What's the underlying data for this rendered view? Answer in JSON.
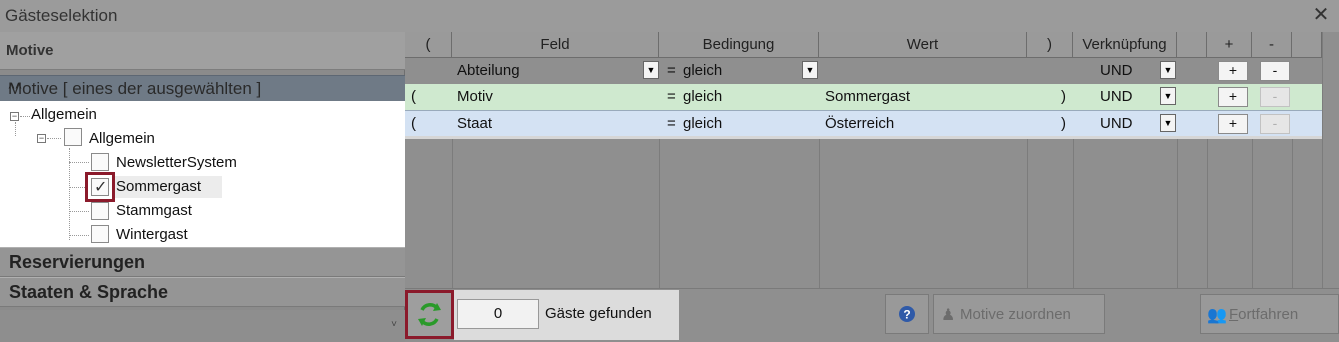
{
  "window": {
    "title": "Gästeselektion",
    "close_icon": "close-icon"
  },
  "left": {
    "motive_header": "Motive",
    "motive_bar": "Motive [ eines der ausgewählten ]",
    "tree": {
      "root": "Allgemein",
      "group": "Allgemein",
      "items": [
        {
          "label": "NewsletterSystem",
          "checked": false
        },
        {
          "label": "Sommergast",
          "checked": true
        },
        {
          "label": "Stammgast",
          "checked": false
        },
        {
          "label": "Wintergast",
          "checked": false
        }
      ]
    },
    "sections": [
      "Reservierungen",
      "Staaten & Sprache"
    ]
  },
  "grid": {
    "headers": [
      "(",
      "Feld",
      "Bedingung",
      "Wert",
      ")",
      "Verknüpfung",
      "+",
      "-"
    ],
    "rows": [
      {
        "open": "",
        "feld": "Abteilung",
        "op": "=",
        "bedingung": "gleich",
        "wert": "",
        "close": "",
        "verkn": "UND",
        "plus": "+",
        "minus": "-",
        "minus_enabled": true
      },
      {
        "open": "(",
        "feld": "Motiv",
        "op": "=",
        "bedingung": "gleich",
        "wert": "Sommergast",
        "close": ")",
        "verkn": "UND",
        "plus": "+",
        "minus": "-",
        "minus_enabled": false
      },
      {
        "open": "(",
        "feld": "Staat",
        "op": "=",
        "bedingung": "gleich",
        "wert": "Österreich",
        "close": ")",
        "verkn": "UND",
        "plus": "+",
        "minus": "-",
        "minus_enabled": false
      }
    ],
    "colors": {
      "row_motiv": "#cfe9cf",
      "row_staat": "#d4e2f3"
    }
  },
  "bottom": {
    "count": "0",
    "found_label": "Gäste gefunden",
    "help_icon": "help-icon",
    "assign_label": "Motive zuordnen",
    "next_label_first": "F",
    "next_label_rest": "ortfahren"
  },
  "accent": {
    "highlight_border": "#8b1a2b"
  }
}
